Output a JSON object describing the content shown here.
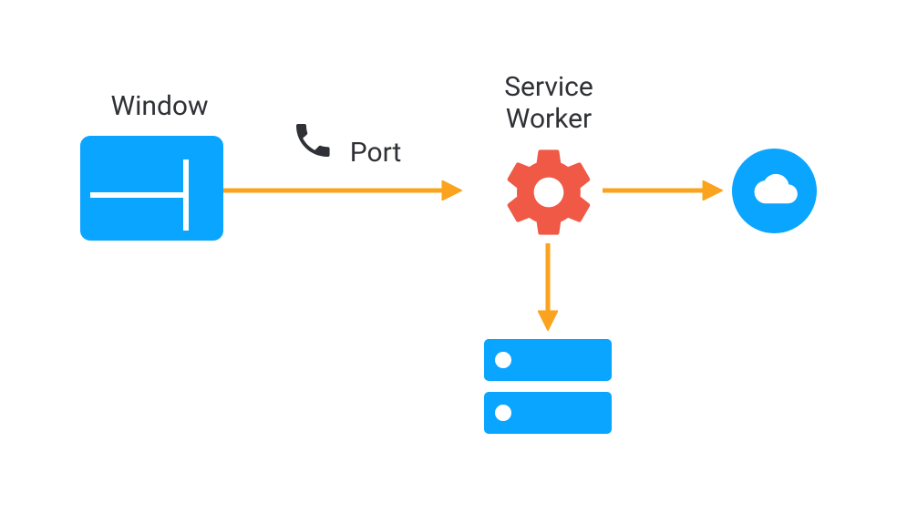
{
  "labels": {
    "window": "Window",
    "port": "Port",
    "service_worker_line1": "Service",
    "service_worker_line2": "Worker"
  },
  "nodes": {
    "window": "window",
    "service_worker": "service-worker",
    "storage": "storage",
    "cloud": "cloud"
  },
  "edges": [
    {
      "from": "window",
      "to": "service-worker",
      "label": "Port"
    },
    {
      "from": "service-worker",
      "to": "storage"
    },
    {
      "from": "service-worker",
      "to": "cloud"
    }
  ],
  "colors": {
    "blue": "#0aa5ff",
    "red": "#ef5946",
    "dark": "#303136",
    "arrow": "#fba31e"
  },
  "icons": {
    "window": "window-icon",
    "phone": "phone-icon",
    "gear": "gear-icon",
    "storage": "storage-icon",
    "cloud": "cloud-icon"
  }
}
